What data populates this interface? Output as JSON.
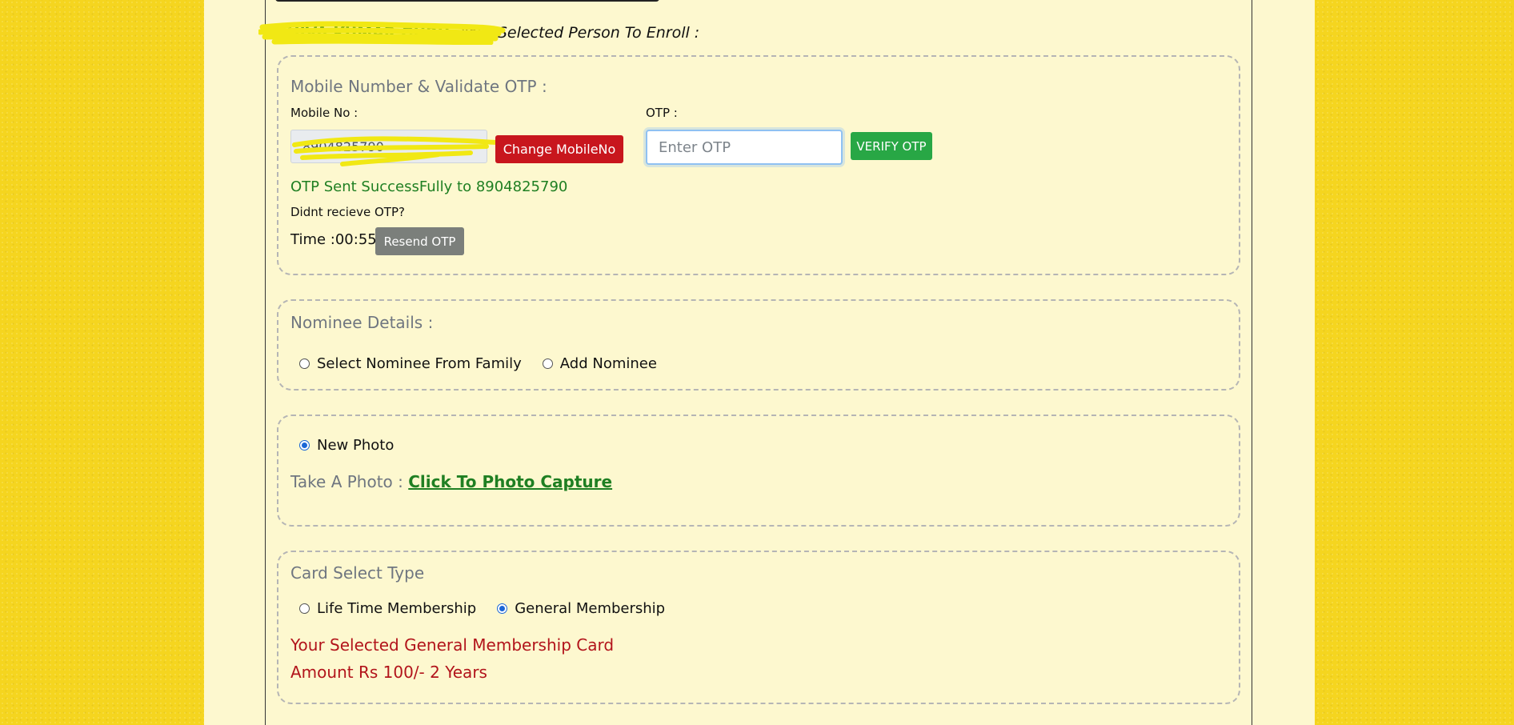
{
  "header": {
    "person_name": "SHIVA KUMAR GURU",
    "selected_caption": "Your Selected Person To Enroll :"
  },
  "otp_section": {
    "title": "Mobile Number & Validate OTP :",
    "mobile_label": "Mobile No :",
    "mobile_value": "8904825790",
    "change_button": "Change MobileNo",
    "otp_label": "OTP :",
    "otp_placeholder": "Enter OTP",
    "verify_button": "VERIFY OTP",
    "status_message": "OTP Sent SuccessFully to 8904825790",
    "didnt_receive": "Didnt recieve OTP?",
    "timer_label": "Time :",
    "timer_value": "00:55",
    "resend_button": "Resend OTP"
  },
  "nominee_section": {
    "title": "Nominee Details :",
    "options": [
      {
        "label": "Select Nominee From Family",
        "checked": false
      },
      {
        "label": "Add Nominee",
        "checked": false
      }
    ]
  },
  "photo_section": {
    "option_label": "New Photo",
    "option_checked": true,
    "take_photo_label": "Take A Photo :",
    "capture_link": "Click To Photo Capture"
  },
  "card_section": {
    "title": "Card Select Type",
    "options": [
      {
        "label": "Life Time Membership",
        "checked": false
      },
      {
        "label": "General Membership",
        "checked": true
      }
    ],
    "selected_message": "Your Selected General Membership Card",
    "amount_message": "Amount Rs 100/- 2 Years"
  },
  "colors": {
    "background": "#f5d51f",
    "panel": "#fdf8cf",
    "success": "#1f7f22",
    "danger": "#c8161d",
    "verify": "#28a745",
    "muted_title": "#6f7680"
  }
}
